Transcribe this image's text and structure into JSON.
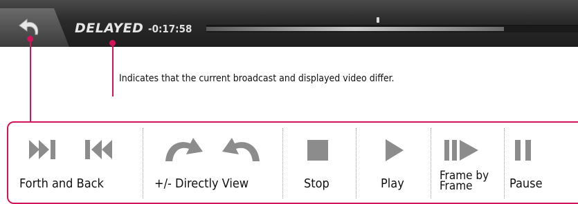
{
  "status_bar": {
    "state_label": "DELAYED",
    "delay_time": "-0:17:58",
    "progress": 0.8
  },
  "annotation": {
    "text": "Indicates that the current broadcast and displayed video differ."
  },
  "controls": [
    {
      "id": "forth-back",
      "label": "Forth and Back",
      "icons": [
        "skip-forward-icon",
        "skip-back-icon"
      ]
    },
    {
      "id": "directly-view",
      "label": "+/- Directly View",
      "icons": [
        "rotate-forward-icon",
        "rotate-back-icon"
      ]
    },
    {
      "id": "stop",
      "label": "Stop",
      "icons": [
        "stop-icon"
      ]
    },
    {
      "id": "play",
      "label": "Play",
      "icons": [
        "play-icon"
      ]
    },
    {
      "id": "frame-by-frame",
      "label": "Frame by\nFrame",
      "icons": [
        "frame-advance-icon"
      ]
    },
    {
      "id": "pause",
      "label": "Pause",
      "icons": [
        "pause-icon"
      ]
    }
  ],
  "colors": {
    "callout": "#d4145a",
    "icon_gray": "#8c8c8c"
  }
}
